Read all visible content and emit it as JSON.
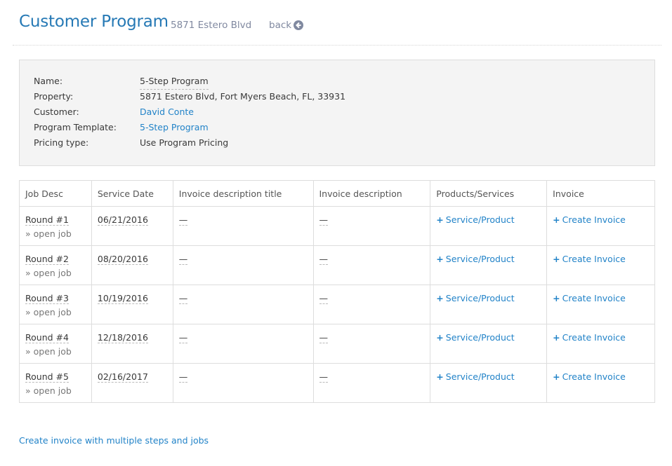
{
  "header": {
    "title": "Customer Program",
    "subtitle": "5871 Estero Blvd",
    "back_label": "back",
    "back_icon": "arrow-circle-left-icon"
  },
  "info": {
    "rows": [
      {
        "label": "Name:",
        "value": "5-Step Program"
      },
      {
        "label": "Property:",
        "value": "5871 Estero Blvd, Fort Myers Beach, FL, 33931"
      },
      {
        "label": "Customer:",
        "value": "David Conte"
      },
      {
        "label": "Program Template:",
        "value": "5-Step Program"
      },
      {
        "label": "Pricing type:",
        "value": "Use Program Pricing"
      }
    ]
  },
  "table": {
    "headers": [
      "Job Desc",
      "Service Date",
      "Invoice description title",
      "Invoice description",
      "Products/Services",
      "Invoice"
    ],
    "open_job_label": "» open job",
    "empty_value": "—",
    "add_service_label": "Service/Product",
    "create_invoice_label": "Create Invoice",
    "rows": [
      {
        "job": "Round #1",
        "date": "06/21/2016"
      },
      {
        "job": "Round #2",
        "date": "08/20/2016"
      },
      {
        "job": "Round #3",
        "date": "10/19/2016"
      },
      {
        "job": "Round #4",
        "date": "12/18/2016"
      },
      {
        "job": "Round #5",
        "date": "02/16/2017"
      }
    ]
  },
  "footer": {
    "multi_invoice_link": "Create invoice with multiple steps and jobs"
  },
  "colors": {
    "accent": "#2679b5",
    "link": "#2283c8",
    "panel_bg": "#f4f4f4"
  }
}
